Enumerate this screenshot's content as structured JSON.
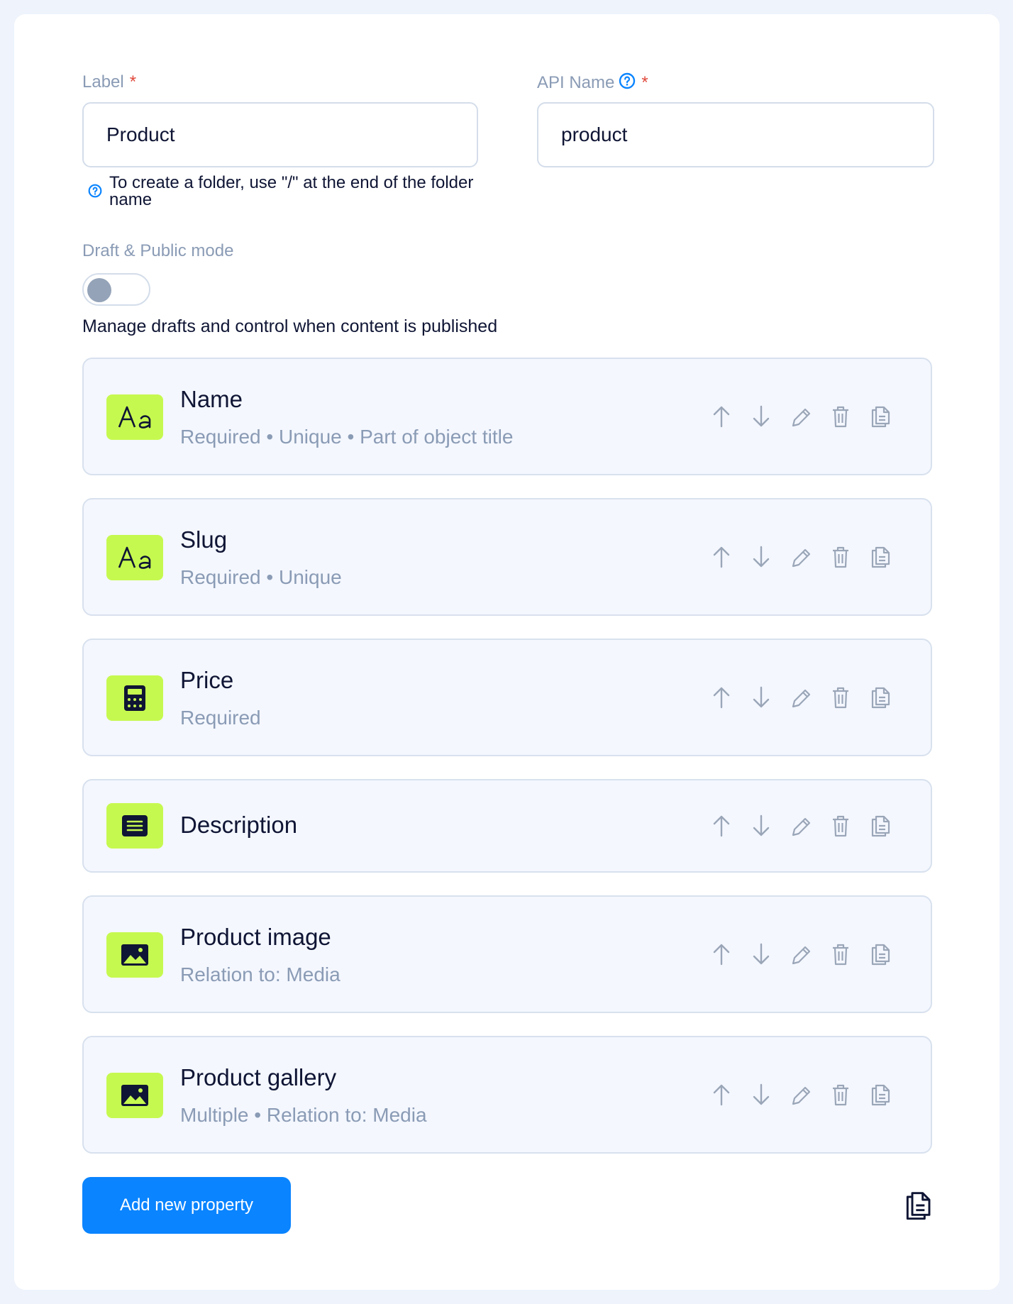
{
  "form": {
    "label": {
      "title": "Label",
      "required_mark": "*",
      "value": "Product",
      "hint": "To create a folder, use \"/\" at the end of the folder name"
    },
    "api_name": {
      "title": "API Name",
      "required_mark": "*",
      "value": "product"
    },
    "draft_mode": {
      "title": "Draft & Public mode",
      "enabled": false,
      "description": "Manage drafts and control when content is published"
    }
  },
  "properties": [
    {
      "title": "Name",
      "subtitle": "Required • Unique • Part of object title",
      "icon": "text-type-icon"
    },
    {
      "title": "Slug",
      "subtitle": "Required • Unique",
      "icon": "text-type-icon"
    },
    {
      "title": "Price",
      "subtitle": "Required",
      "icon": "calculator-icon"
    },
    {
      "title": "Description",
      "subtitle": "",
      "icon": "text-block-icon"
    },
    {
      "title": "Product image",
      "subtitle": "Relation to: Media",
      "icon": "image-icon"
    },
    {
      "title": "Product gallery",
      "subtitle": "Multiple • Relation to: Media",
      "icon": "image-icon"
    }
  ],
  "actions": {
    "add_property_label": "Add new property"
  },
  "colors": {
    "accent": "#0a84ff",
    "badge": "#c6f94f",
    "required": "#e0493c"
  }
}
